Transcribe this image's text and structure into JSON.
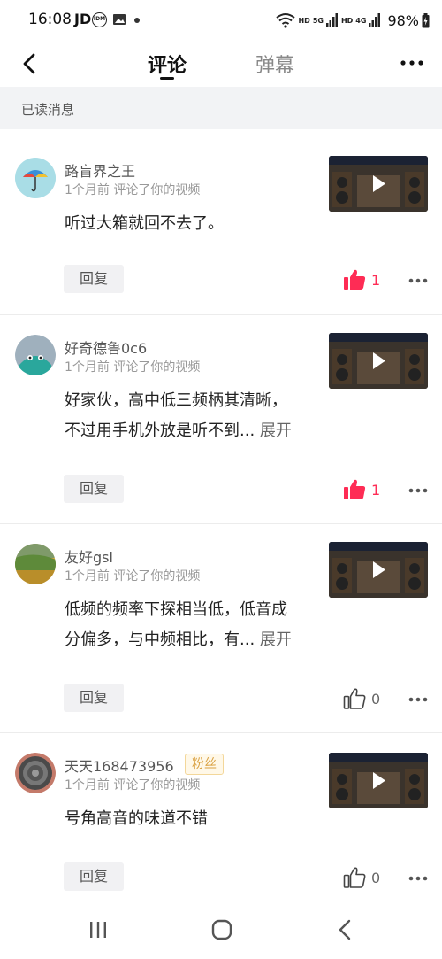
{
  "status_bar": {
    "time": "16:08",
    "app_label": "JD",
    "idm_label": "IDM",
    "network": "HD",
    "signal_1": "5G",
    "signal_2": "4G",
    "battery": "98%"
  },
  "header": {
    "tabs": [
      {
        "label": "评论",
        "active": true
      },
      {
        "label": "弹幕",
        "active": false
      }
    ]
  },
  "read_section": {
    "label": "已读消息"
  },
  "comments": [
    {
      "username": "路盲界之王",
      "meta": "1个月前 评论了你的视频",
      "text_lines": [
        "听过大箱就回不去了。"
      ],
      "expand": "",
      "reply_label": "回复",
      "likes": "1",
      "liked": true,
      "fan_badge": ""
    },
    {
      "username": "好奇德鲁0c6",
      "meta": "1个月前 评论了你的视频",
      "text_lines": [
        "好家伙，高中低三频柄其清晰，",
        "不过用手机外放是听不到..."
      ],
      "expand": "展开",
      "reply_label": "回复",
      "likes": "1",
      "liked": true,
      "fan_badge": ""
    },
    {
      "username": "友好gsl",
      "meta": "1个月前 评论了你的视频",
      "text_lines": [
        "低频的频率下探相当低，低音成",
        "分偏多，与中频相比，有..."
      ],
      "expand": "展开",
      "reply_label": "回复",
      "likes": "0",
      "liked": false,
      "fan_badge": ""
    },
    {
      "username": "天天168473956",
      "meta": "1个月前 评论了你的视频",
      "text_lines": [
        "号角高音的味道不错"
      ],
      "expand": "",
      "reply_label": "回复",
      "likes": "0",
      "liked": false,
      "fan_badge": "粉丝"
    }
  ],
  "colors": {
    "like_active": "#fe2c55",
    "accent_badge": "#d9a040"
  }
}
